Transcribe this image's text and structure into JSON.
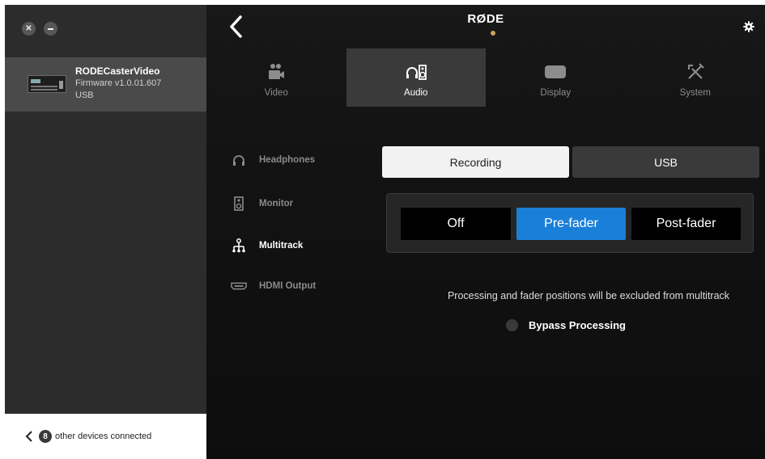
{
  "window": {
    "close_icon": "close-icon",
    "minimize_icon": "minimize-icon"
  },
  "device": {
    "name": "RODECasterVideo",
    "firmware": "Firmware v1.0.01.607",
    "connection": "USB"
  },
  "footer": {
    "count": "8",
    "text": "other devices connected"
  },
  "header": {
    "brand": "RØDE",
    "accent_color": "#c8a660"
  },
  "tabs": [
    {
      "label": "Video",
      "icon": "video-camera-icon",
      "active": false
    },
    {
      "label": "Audio",
      "icon": "headphones-speaker-icon",
      "active": true
    },
    {
      "label": "Display",
      "icon": "display-icon",
      "active": false
    },
    {
      "label": "System",
      "icon": "tools-icon",
      "active": false
    }
  ],
  "subnav": [
    {
      "label": "Headphones",
      "icon": "headphones-icon",
      "selected": false
    },
    {
      "label": "Monitor",
      "icon": "speaker-icon",
      "selected": false
    },
    {
      "label": "Multitrack",
      "icon": "multitrack-icon",
      "selected": true
    },
    {
      "label": "HDMI Output",
      "icon": "hdmi-icon",
      "selected": false
    }
  ],
  "source_toggle": {
    "options": [
      "Recording",
      "USB"
    ],
    "selected": "Recording"
  },
  "mode": {
    "options": [
      "Off",
      "Pre-fader",
      "Post-fader"
    ],
    "selected": "Pre-fader",
    "selected_color": "#1a7fd8"
  },
  "info_text": "Processing and fader positions will be excluded from multitrack",
  "bypass": {
    "label": "Bypass Processing",
    "checked": false
  }
}
